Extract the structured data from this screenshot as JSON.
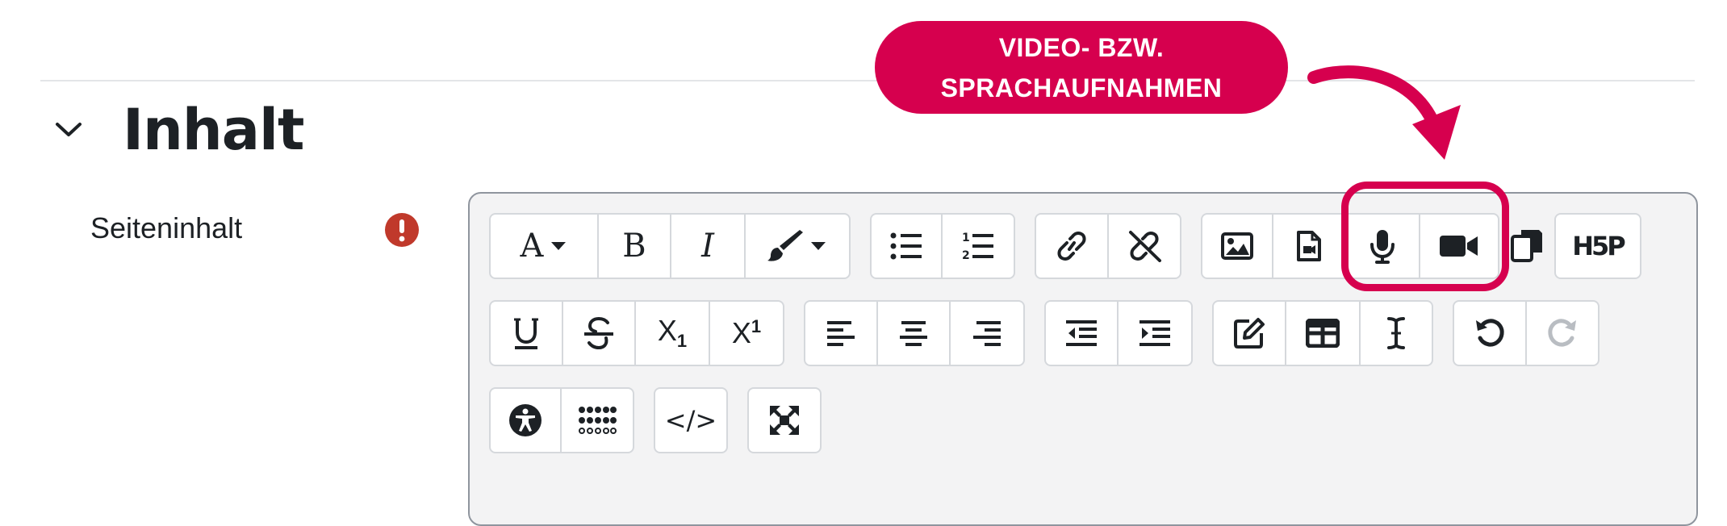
{
  "section": {
    "title": "Inhalt"
  },
  "field": {
    "label": "Seiteninhalt"
  },
  "callout": {
    "line1": "VIDEO- BZW.",
    "line2": "SPRACHAUFNAHMEN"
  },
  "toolbar": {
    "font_letter": "A",
    "bold": "B",
    "italic": "I",
    "subscript_letter": "X",
    "subscript_digit": "1",
    "superscript_letter": "X",
    "superscript_digit": "1",
    "h5p_label": "H5P",
    "html_label": "</>"
  },
  "colors": {
    "accent": "#d6004e",
    "required": "#c0392b",
    "toolbar_bg": "#f3f3f4"
  },
  "icons": [
    "chevron-down-icon",
    "required-icon",
    "font-icon",
    "bold-icon",
    "italic-icon",
    "brush-icon",
    "unordered-list-icon",
    "ordered-list-icon",
    "link-icon",
    "unlink-icon",
    "image-icon",
    "media-icon",
    "microphone-icon",
    "video-camera-icon",
    "copy-icon",
    "h5p-icon",
    "underline-icon",
    "strikethrough-icon",
    "subscript-icon",
    "superscript-icon",
    "align-left-icon",
    "align-center-icon",
    "align-right-icon",
    "outdent-icon",
    "indent-icon",
    "edit-icon",
    "table-icon",
    "cursor-icon",
    "undo-icon",
    "redo-icon",
    "accessibility-icon",
    "screenreader-icon",
    "html-icon",
    "fullscreen-icon",
    "curved-arrow-icon"
  ]
}
